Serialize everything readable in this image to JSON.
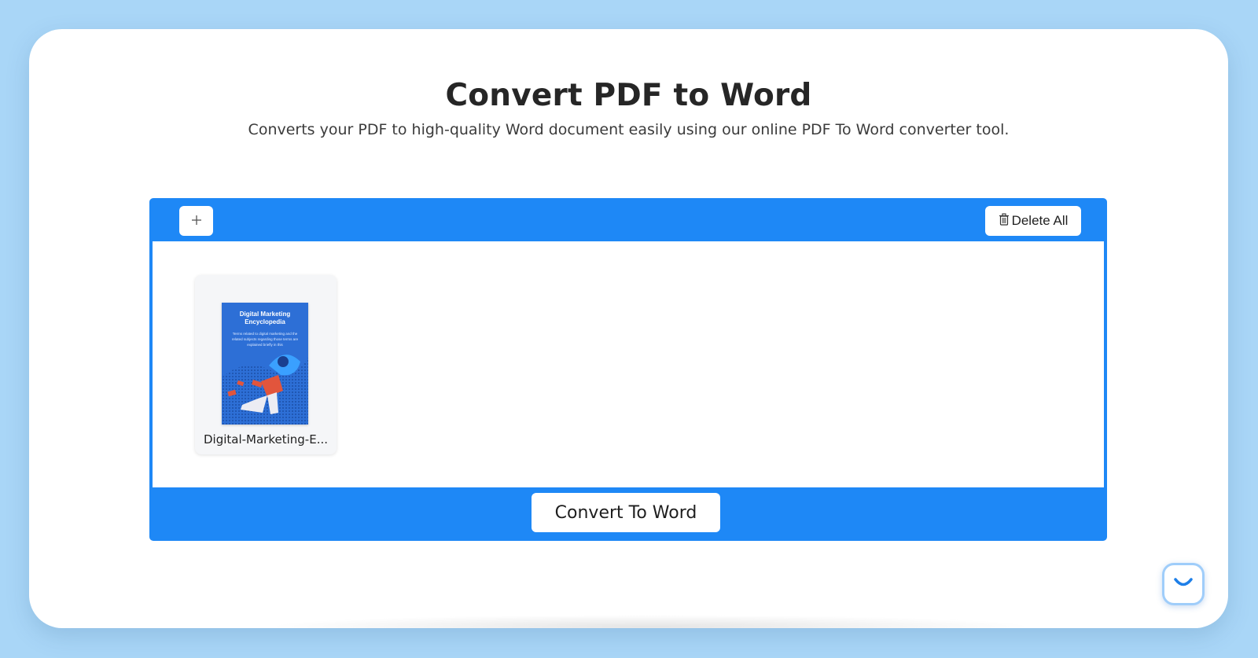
{
  "header": {
    "title": "Convert PDF to Word",
    "subtitle": "Converts your PDF to high-quality Word document easily using our online PDF To Word converter tool."
  },
  "toolbar": {
    "add_icon": "plus-icon",
    "delete_all_label": "Delete All",
    "delete_icon": "trash-icon"
  },
  "files": [
    {
      "name": "Digital-Marketing-E...",
      "thumbnail_title": "Digital Marketing Encyclopedia",
      "thumbnail_text": "Terms related to digital marketing and the related subjects regarding those terms are explained briefly in this"
    }
  ],
  "actions": {
    "convert_label": "Convert To Word"
  },
  "colors": {
    "accent": "#1e88f6",
    "background": "#a9d6f7",
    "card": "#ffffff"
  },
  "chat_widget": {
    "icon": "smile-chat-icon"
  }
}
